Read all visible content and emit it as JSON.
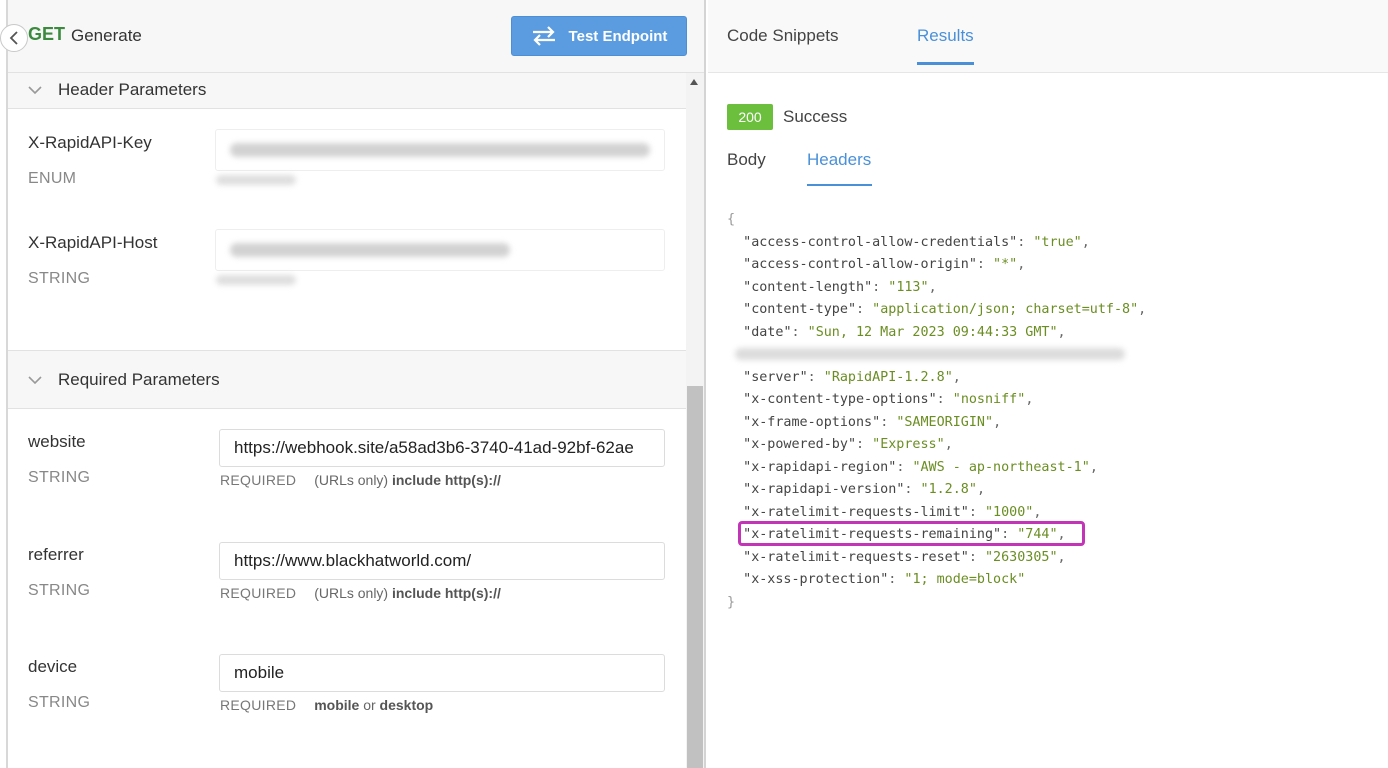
{
  "header": {
    "method": "GET",
    "endpoint_name": "Generate",
    "test_button_label": "Test Endpoint"
  },
  "sections": {
    "header_params_title": "Header Parameters",
    "required_params_title": "Required Parameters"
  },
  "header_params": [
    {
      "name": "X-RapidAPI-Key",
      "type": "ENUM"
    },
    {
      "name": "X-RapidAPI-Host",
      "type": "STRING"
    }
  ],
  "required_params": [
    {
      "name": "website",
      "type": "STRING",
      "value": "https://webhook.site/a58ad3b6-3740-41ad-92bf-62ae",
      "req": "REQUIRED",
      "hint_plain": "(URLs only)",
      "hint_bold": "include http(s)://"
    },
    {
      "name": "referrer",
      "type": "STRING",
      "value": "https://www.blackhatworld.com/",
      "req": "REQUIRED",
      "hint_plain": "(URLs only)",
      "hint_bold": "include http(s)://"
    },
    {
      "name": "device",
      "type": "STRING",
      "value": "mobile",
      "req": "REQUIRED",
      "hint_bold_1": "mobile",
      "hint_or": "or",
      "hint_bold_2": "desktop"
    }
  ],
  "right": {
    "tabs": [
      "Code Snippets",
      "Results"
    ],
    "active_tab": "Results",
    "status_code": "200",
    "status_text": "Success",
    "subtabs": [
      "Body",
      "Headers"
    ],
    "active_subtab": "Headers",
    "json_open": "{",
    "json_close": "}",
    "headers": [
      {
        "key": "access-control-allow-credentials",
        "value": "true"
      },
      {
        "key": "access-control-allow-origin",
        "value": "*"
      },
      {
        "key": "content-length",
        "value": "113"
      },
      {
        "key": "content-type",
        "value": "application/json; charset=utf-8"
      },
      {
        "key": "date",
        "value": "Sun, 12 Mar 2023 09:44:33 GMT"
      },
      {
        "key": "server",
        "value": "RapidAPI-1.2.8"
      },
      {
        "key": "x-content-type-options",
        "value": "nosniff"
      },
      {
        "key": "x-frame-options",
        "value": "SAMEORIGIN"
      },
      {
        "key": "x-powered-by",
        "value": "Express"
      },
      {
        "key": "x-rapidapi-region",
        "value": "AWS - ap-northeast-1"
      },
      {
        "key": "x-rapidapi-version",
        "value": "1.2.8"
      },
      {
        "key": "x-ratelimit-requests-limit",
        "value": "1000"
      },
      {
        "key": "x-ratelimit-requests-remaining",
        "value": "744"
      },
      {
        "key": "x-ratelimit-requests-reset",
        "value": "2630305"
      },
      {
        "key": "x-xss-protection",
        "value": "1; mode=block"
      }
    ],
    "highlight_color": "#c335b7"
  },
  "colors": {
    "accent": "#4a90d9",
    "button": "#5b9ce0",
    "method_get": "#3b8a3e",
    "success": "#6cbf3d",
    "json_value": "#6b8e23"
  }
}
